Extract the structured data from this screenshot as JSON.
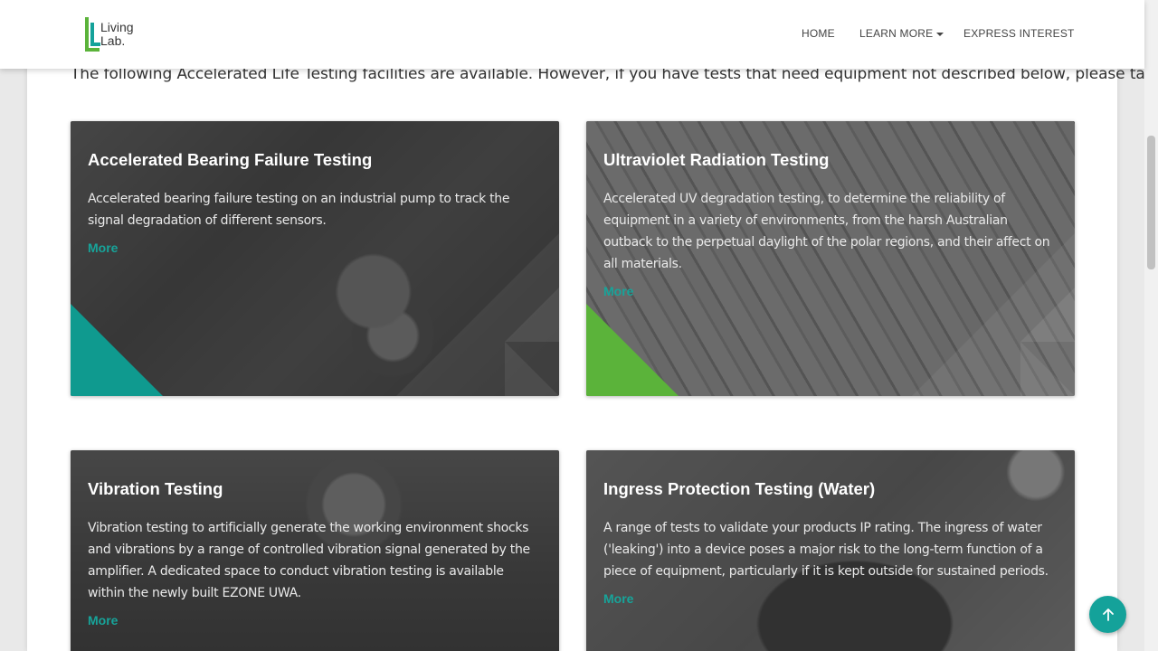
{
  "brand": {
    "name_line1": "Living",
    "name_line2": "Lab."
  },
  "nav": {
    "home": "HOME",
    "learn_more": "LEARN MORE",
    "express_interest": "EXPRESS INTEREST"
  },
  "intro": "The following Accelerated Life Testing facilities are available. However, if you have tests that need equipment not described below, please talk to us.",
  "cards": [
    {
      "title": "Accelerated Bearing Failure Testing",
      "description": "Accelerated bearing failure testing on an industrial pump to track the signal degradation of different sensors.",
      "link": "More",
      "accent": "#0f9a8f"
    },
    {
      "title": "Ultraviolet Radiation Testing",
      "description": "Accelerated UV degradation testing, to determine the reliability of equipment in a variety of environments, from the harsh Australian outback to the perpetual daylight of the polar regions, and their affect on all materials.",
      "link": "More",
      "accent": "#5bb33a"
    },
    {
      "title": "Vibration Testing",
      "description": "Vibration testing to artificially generate the working environment shocks and vibrations by a range of controlled vibration signal generated by the amplifier. A dedicated space to conduct vibration testing is available within the newly built EZONE UWA.",
      "link": "More",
      "accent": "#0f9a8f"
    },
    {
      "title": "Ingress Protection Testing (Water)",
      "description": "A range of tests to validate your products IP rating. The ingress of water ('leaking') into a device poses a major risk to the long-term function of a piece of equipment, particularly if it is kept outside for sustained periods.",
      "link": "More",
      "accent": "#5bb33a"
    }
  ],
  "colors": {
    "teal": "#14a29a",
    "green": "#5bb33a",
    "link": "#17a49a"
  },
  "icons": {
    "back_to_top": "arrow-up-icon",
    "dropdown": "caret-down-icon"
  }
}
